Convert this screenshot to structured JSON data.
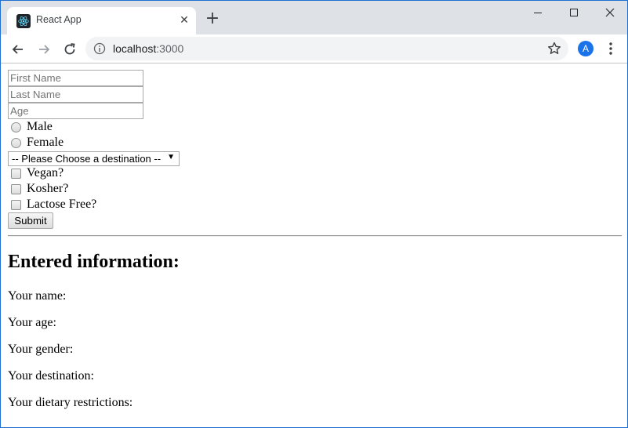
{
  "tab": {
    "title": "React App",
    "close": "✕",
    "new_tab": "+"
  },
  "toolbar": {
    "url_host": "localhost",
    "url_port": ":3000",
    "avatar_letter": "A"
  },
  "form": {
    "first_name_placeholder": "First Name",
    "last_name_placeholder": "Last Name",
    "age_placeholder": "Age",
    "gender_options": [
      "Male",
      "Female"
    ],
    "destination_selected": "-- Please Choose a destination --",
    "dietary_options": [
      "Vegan?",
      "Kosher?",
      "Lactose Free?"
    ],
    "submit_label": "Submit"
  },
  "results": {
    "heading": "Entered information:",
    "lines": [
      "Your name:",
      "Your age:",
      "Your gender:",
      "Your destination:",
      "Your dietary restrictions:"
    ]
  },
  "icons": {
    "favicon": "react-logo-icon",
    "back": "back-arrow-icon",
    "forward": "forward-arrow-icon",
    "reload": "reload-icon",
    "info": "info-icon",
    "star": "star-icon",
    "menu": "kebab-menu-icon"
  },
  "colors": {
    "tabbar": "#dee1e6",
    "omnibox": "#f1f3f4",
    "avatar": "#1a73e8",
    "react": "#61dafb"
  }
}
